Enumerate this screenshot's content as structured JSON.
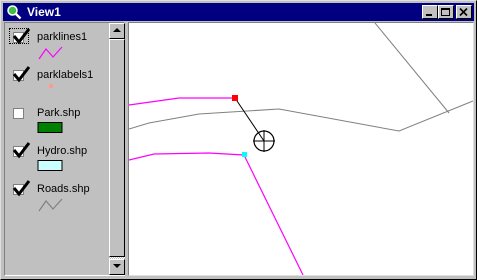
{
  "window": {
    "title": "View1",
    "app_icon": "search-magnifier-icon"
  },
  "title_buttons": {
    "minimize": "minimize-icon",
    "maximize": "maximize-icon",
    "close": "close-icon"
  },
  "toc": {
    "layers": [
      {
        "name": "parklines1",
        "checked": true,
        "selected": true,
        "symbol": "line",
        "color": "#ff00ff"
      },
      {
        "name": "parklabels1",
        "checked": true,
        "selected": false,
        "symbol": "point",
        "color": "#ff9999"
      },
      {
        "name": "Park.shp",
        "checked": false,
        "selected": false,
        "symbol": "fill",
        "color": "#008000"
      },
      {
        "name": "Hydro.shp",
        "checked": true,
        "selected": false,
        "symbol": "fill",
        "color": "#ccffff"
      },
      {
        "name": "Roads.shp",
        "checked": true,
        "selected": false,
        "symbol": "line",
        "color": "#808080"
      }
    ]
  },
  "map": {
    "colors": {
      "roads": "#808080",
      "parklines": "#ff00ff",
      "vertex_selected": "#ff0000",
      "vertex_snap": "#00ffff",
      "cursor": "#000000"
    }
  }
}
